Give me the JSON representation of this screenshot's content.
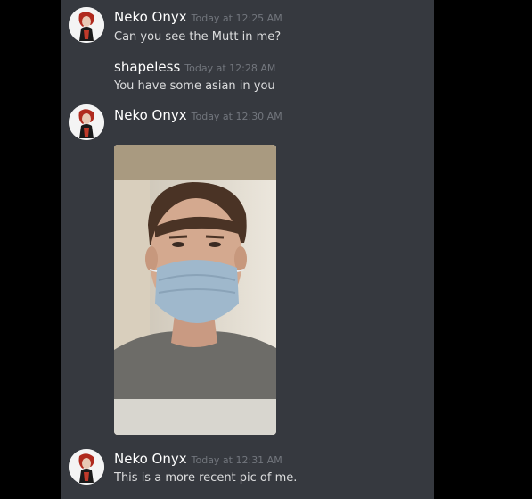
{
  "messages": [
    {
      "author": "Neko Onyx",
      "timestamp": "Today at 12:25 AM",
      "text": "Can you see the Mutt in me?"
    },
    {
      "author": "shapeless",
      "timestamp": "Today at 12:28 AM",
      "text": "You have some asian in you"
    },
    {
      "author": "Neko Onyx",
      "timestamp": "Today at 12:30 AM",
      "attachment": "photo"
    },
    {
      "author": "Neko Onyx",
      "timestamp": "Today at 12:31 AM",
      "text": "This is a more recent pic of me."
    }
  ],
  "colors": {
    "chat_background": "#36393f",
    "outer_background": "#000000",
    "username": "#ffffff",
    "timestamp": "#72767d",
    "message_text": "#dcddde"
  }
}
